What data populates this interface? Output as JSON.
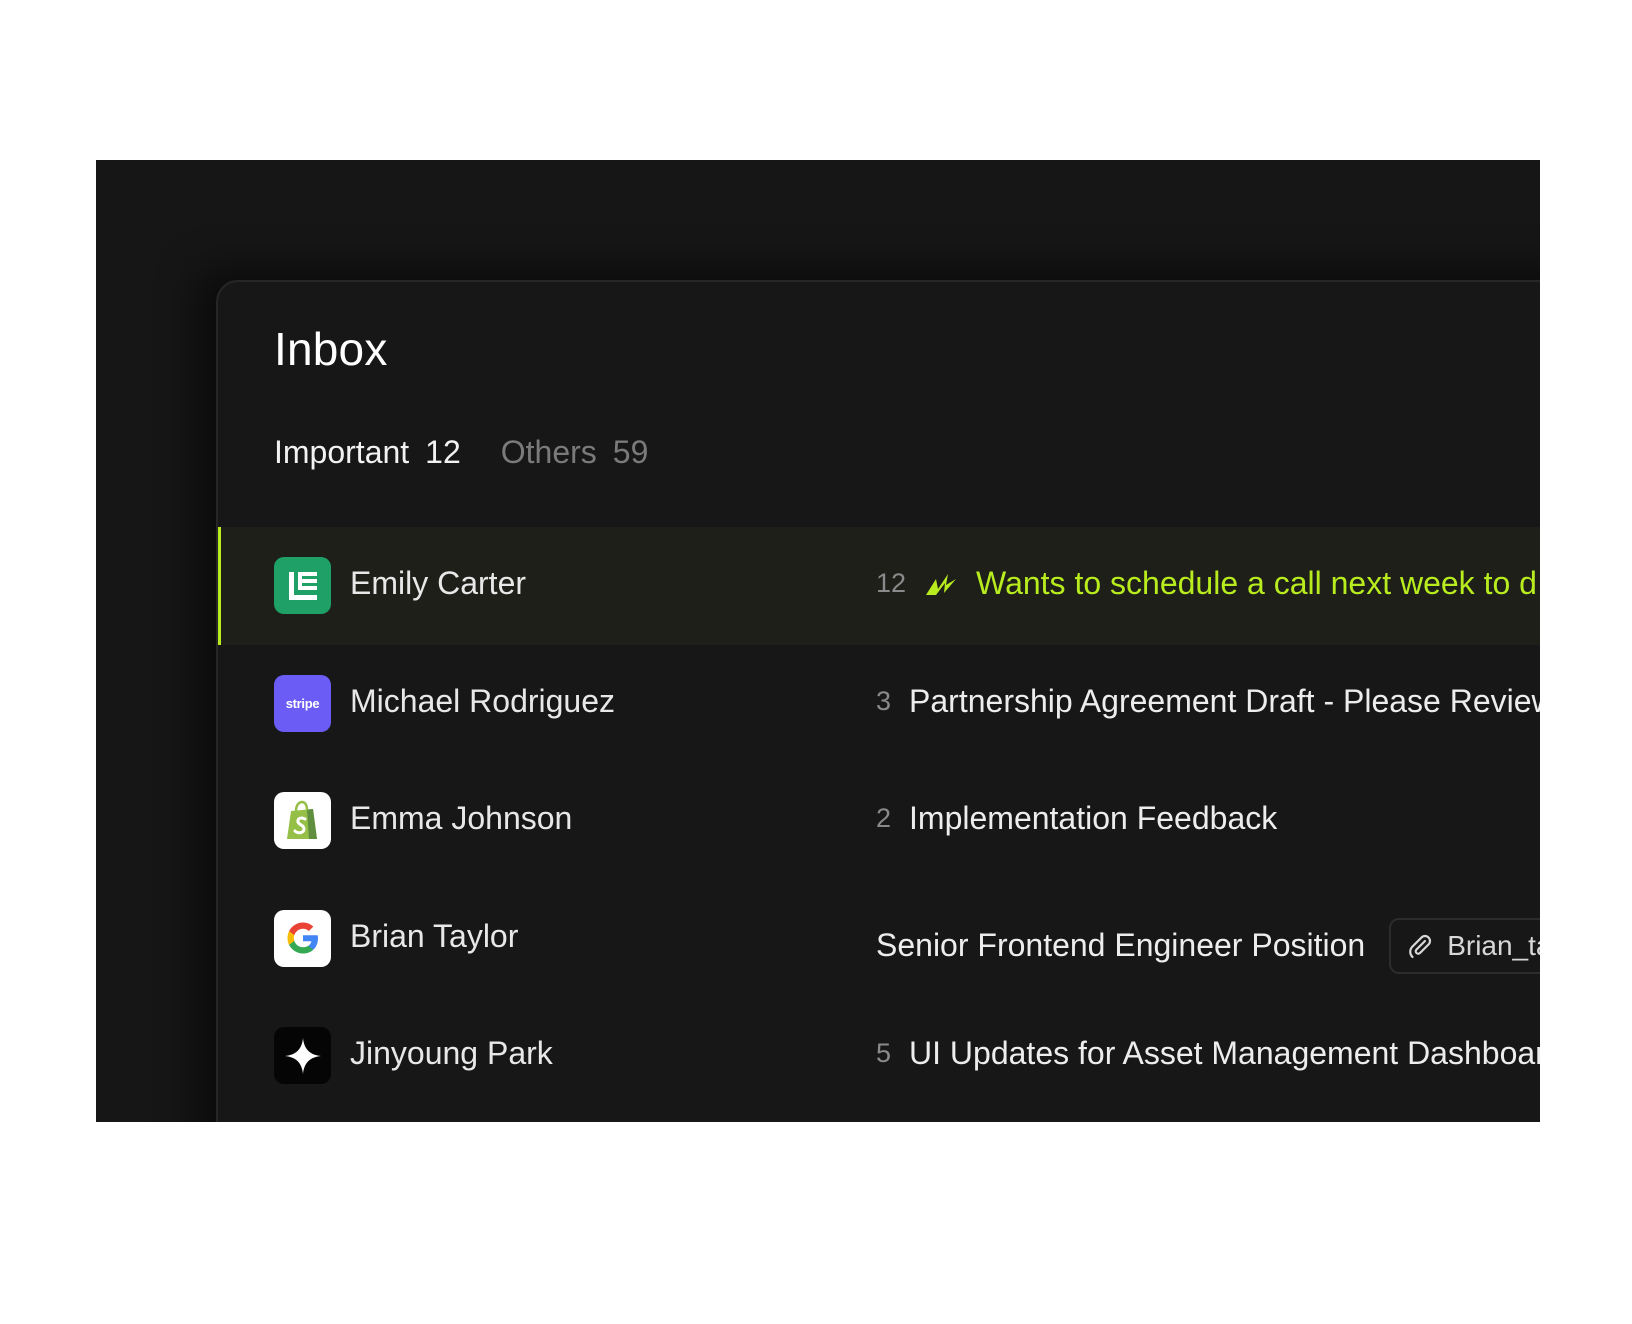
{
  "inbox": {
    "title": "Inbox",
    "tabs": [
      {
        "label": "Important",
        "count": "12",
        "active": true
      },
      {
        "label": "Others",
        "count": "59",
        "active": false
      }
    ],
    "rows": [
      {
        "sender": "Emily Carter",
        "count": "12",
        "subject": "Wants to schedule a call next week to d",
        "avatar": "ledger-logo-icon",
        "highlight": true
      },
      {
        "sender": "Michael Rodriguez",
        "count": "3",
        "subject": "Partnership Agreement Draft - Please Review",
        "avatar": "stripe-logo-icon",
        "avatar_text": "stripe"
      },
      {
        "sender": "Emma Johnson",
        "count": "2",
        "subject": "Implementation Feedback",
        "avatar": "shopify-logo-icon"
      },
      {
        "sender": "Brian Taylor",
        "subject": "Senior Frontend Engineer Position",
        "attachment": "Brian_ta",
        "avatar": "google-logo-icon"
      },
      {
        "sender": "Jinyoung Park",
        "count": "5",
        "subject": "UI Updates for Asset Management Dashboard",
        "avatar": "sparkle-logo-icon"
      }
    ]
  },
  "colors": {
    "accent": "#b8ec1e",
    "background": "#171717",
    "selected_row": "#1d1f18",
    "ledger": "#1ea067",
    "stripe": "#6c5cf6"
  }
}
